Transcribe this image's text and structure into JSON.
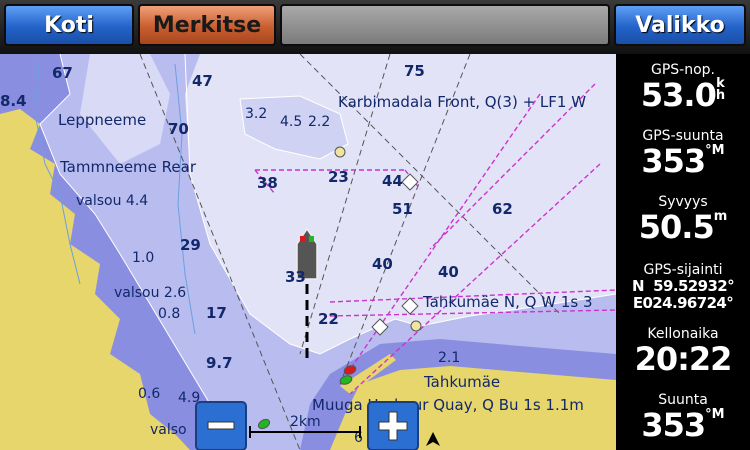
{
  "topbar": {
    "home_label": "Koti",
    "mark_label": "Merkitse",
    "menu_label": "Valikko"
  },
  "sidebar": {
    "gps_speed": {
      "label": "GPS-nop.",
      "value": "53.0",
      "unit_top": "k",
      "unit_bottom": "h"
    },
    "gps_course": {
      "label": "GPS-suunta",
      "value": "353",
      "unit": "°M"
    },
    "depth": {
      "label": "Syvyys",
      "value": "50.5",
      "unit": "m"
    },
    "gps_position": {
      "label": "GPS-sijainti",
      "lat": "N  59.52932°",
      "lon": "E024.96724°"
    },
    "time": {
      "label": "Kellonaika",
      "value": "20:22"
    },
    "heading": {
      "label": "Suunta",
      "value": "353",
      "unit": "°M"
    }
  },
  "map": {
    "place_labels": {
      "leppneeme": "Leppneeme",
      "tammneeme": "Tammneeme Rear",
      "karbimadala": "Karbimadala Front, Q(3) + LF1 W",
      "tahkumae_n": "Tahkumäe N, Q W 1s 3",
      "tahkumae": "Tahkumäe",
      "muuga": "Muuga Harbour Quay, Q Bu 1s 1.1m",
      "valsou_44": "valsou 4.4",
      "valsou_26": "valsou 2.6",
      "valso": "valso"
    },
    "depths": [
      "67",
      "47",
      "75",
      "8.4",
      "70",
      "3.2",
      "4.5",
      "2.2",
      "38",
      "23",
      "44",
      "51",
      "62",
      "29",
      "40",
      "40",
      "1.0",
      "33",
      "0.8",
      "17",
      "22",
      "9.7",
      "2.1",
      "0.6",
      "4.9",
      "6"
    ],
    "scale_label": "2km",
    "colors": {
      "land": "#e6d66b",
      "shallow": "#8a8ee0",
      "mid": "#b9bcef",
      "deep": "#e3e3f7",
      "contour": "#ffffff",
      "route": "#cc33cc",
      "depth_text": "#12286b"
    }
  }
}
